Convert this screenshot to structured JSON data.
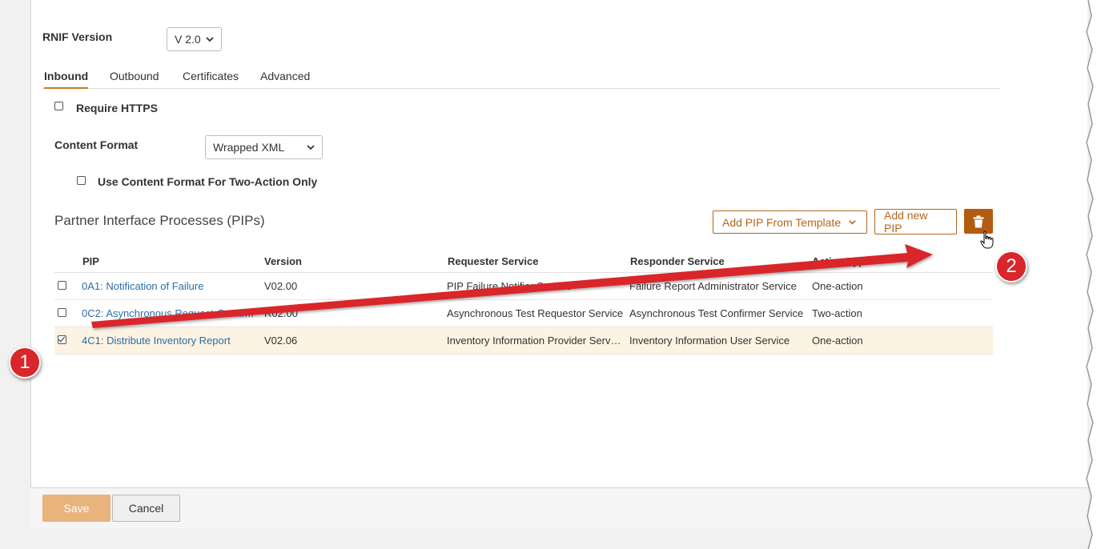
{
  "rnif": {
    "label": "RNIF Version",
    "selected": "V 2.0"
  },
  "tabs": [
    {
      "label": "Inbound",
      "active": true
    },
    {
      "label": "Outbound",
      "active": false
    },
    {
      "label": "Certificates",
      "active": false
    },
    {
      "label": "Advanced",
      "active": false
    }
  ],
  "require_https": {
    "label": "Require HTTPS",
    "checked": false
  },
  "content_format": {
    "label": "Content Format",
    "selected": "Wrapped XML"
  },
  "two_action_only": {
    "label": "Use Content Format For Two-Action Only",
    "checked": false
  },
  "pips": {
    "title": "Partner Interface Processes (PIPs)",
    "add_from_template_label": "Add PIP From Template",
    "add_new_label": "Add new PIP",
    "delete_icon": "trash-icon",
    "columns": [
      "PIP",
      "Version",
      "Requester Service",
      "Responder Service",
      "Action Type"
    ],
    "rows": [
      {
        "pip": "0A1: Notification of Failure",
        "version": "V02.00",
        "requester": "PIP Failure Notifier Service",
        "responder": "Failure Report Administrator Service",
        "action": "One-action",
        "checked": false
      },
      {
        "pip": "0C2: Asynchronous Request-Confirm",
        "version": "R02.00",
        "requester": "Asynchronous Test Requestor Service",
        "responder": "Asynchronous Test Confirmer Service",
        "action": "Two-action",
        "checked": false
      },
      {
        "pip": "4C1: Distribute Inventory Report",
        "version": "V02.06",
        "requester": "Inventory Information Provider Serv…",
        "responder": "Inventory Information User Service",
        "action": "One-action",
        "checked": true
      }
    ]
  },
  "footer": {
    "save_label": "Save",
    "cancel_label": "Cancel"
  },
  "annotations": {
    "step1": "1",
    "step2": "2"
  },
  "colors": {
    "accent": "#b5651d",
    "delete_bg": "#b35c0f",
    "save_bg": "#e8b37c",
    "link": "#2a6ea8",
    "selected_row": "#fdf3e3",
    "callout": "#d9262b",
    "arrow": "#d9262b"
  }
}
